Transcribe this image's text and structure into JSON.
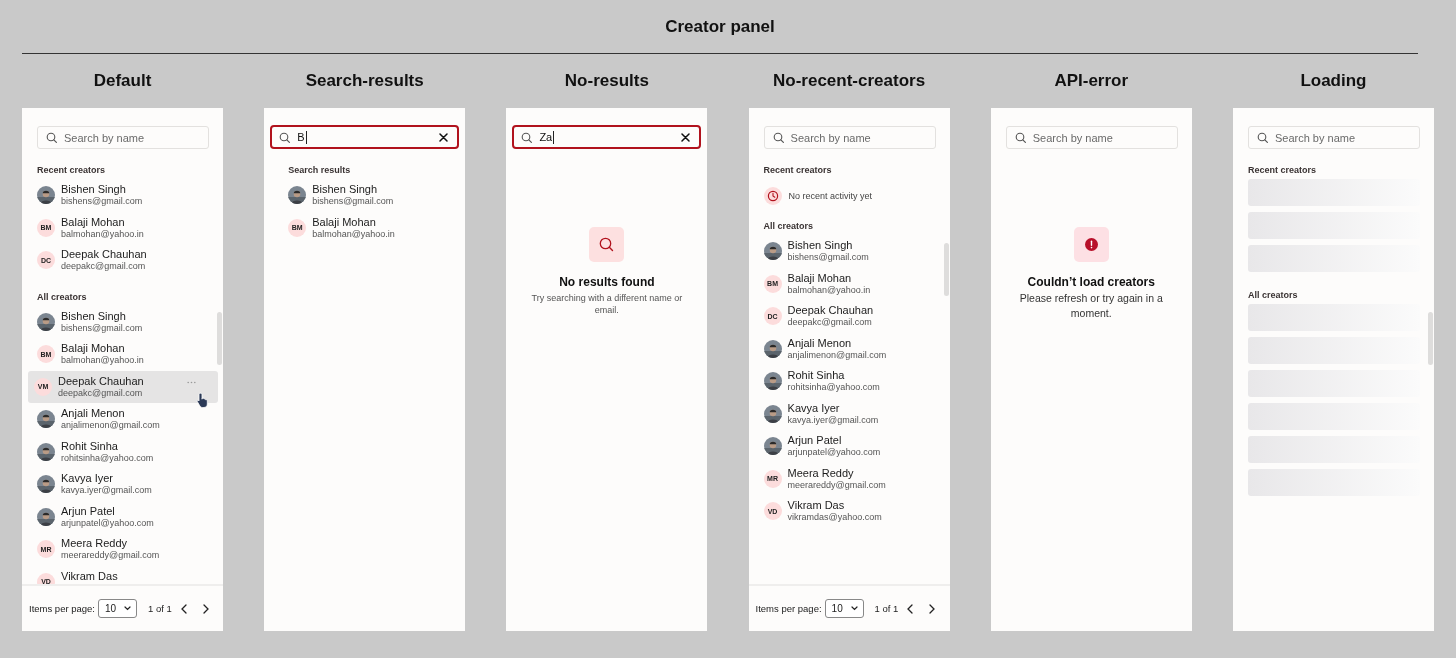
{
  "title": "Creator panel",
  "panels": [
    {
      "kind": "default",
      "title": "Default",
      "search": {
        "placeholder": "Search by name",
        "focused": false
      },
      "sections": [
        {
          "heading": "Recent creators",
          "items": [
            {
              "kind": "creator",
              "name": "Bishen Singh",
              "email": "bishens@gmail.com",
              "hovered": false
            },
            {
              "kind": "creator",
              "name": "Balaji Mohan",
              "email": "balmohan@yahoo.in",
              "avatar": {
                "kind": "initials",
                "text": "BM"
              },
              "hovered": false
            },
            {
              "kind": "creator",
              "name": "Deepak Chauhan",
              "email": "deepakc@gmail.com",
              "avatar": {
                "kind": "initials",
                "text": "DC"
              },
              "hovered": false
            }
          ]
        },
        {
          "heading": "All creators",
          "items": [
            {
              "kind": "creator",
              "name": "Bishen Singh",
              "email": "bishens@gmail.com",
              "hovered": false
            },
            {
              "kind": "creator",
              "name": "Balaji Mohan",
              "email": "balmohan@yahoo.in",
              "avatar": {
                "kind": "initials",
                "text": "BM"
              },
              "hovered": false
            },
            {
              "kind": "creator",
              "name": "Deepak Chauhan",
              "email": "deepakc@gmail.com",
              "avatar": {
                "kind": "initials",
                "text": "VM"
              },
              "hovered": true
            },
            {
              "kind": "creator",
              "name": "Anjali Menon",
              "email": "anjalimenon@gmail.com",
              "hovered": false
            },
            {
              "kind": "creator",
              "name": "Rohit Sinha",
              "email": "rohitsinha@yahoo.com",
              "hovered": false
            },
            {
              "kind": "creator",
              "name": "Kavya Iyer",
              "email": "kavya.iyer@gmail.com",
              "hovered": false
            },
            {
              "kind": "creator",
              "name": "Arjun Patel",
              "email": "arjunpatel@yahoo.com",
              "hovered": false
            },
            {
              "kind": "creator",
              "name": "Meera Reddy",
              "email": "meerareddy@gmail.com",
              "avatar": {
                "kind": "initials",
                "text": "MR"
              },
              "hovered": false
            },
            {
              "kind": "creator",
              "name": "Vikram Das",
              "avatar": {
                "kind": "initials",
                "text": "VD"
              },
              "hovered": false
            }
          ]
        }
      ],
      "pagination": {
        "label": "Items per page:",
        "per_page": "10",
        "page": "1 of 1"
      }
    },
    {
      "kind": "search",
      "title": "Search-results",
      "search": {
        "value": "B",
        "focused": true
      },
      "sections": [
        {
          "heading": "Search results",
          "items": [
            {
              "kind": "creator",
              "name": "Bishen Singh",
              "email": "bishens@gmail.com",
              "hovered": false
            },
            {
              "kind": "creator",
              "name": "Balaji Mohan",
              "email": "balmohan@yahoo.in",
              "avatar": {
                "kind": "initials",
                "text": "BM"
              },
              "hovered": false
            }
          ]
        }
      ]
    },
    {
      "kind": "no-results",
      "title": "No-results",
      "search": {
        "value": "Za",
        "focused": true
      },
      "message": {
        "kind": "no-results",
        "title": "No results found",
        "text": "Try searching with a different name or email."
      }
    },
    {
      "kind": "no-recent",
      "title": "No-recent-creators",
      "search": {
        "placeholder": "Search by name",
        "focused": false
      },
      "sections": [
        {
          "heading": "Recent creators",
          "items": [
            {
              "kind": "empty",
              "text": "No recent activity yet"
            }
          ]
        },
        {
          "heading": "All creators",
          "items": [
            {
              "kind": "creator",
              "name": "Bishen Singh",
              "email": "bishens@gmail.com",
              "hovered": false
            },
            {
              "kind": "creator",
              "name": "Balaji Mohan",
              "email": "balmohan@yahoo.in",
              "avatar": {
                "kind": "initials",
                "text": "BM"
              },
              "hovered": false
            },
            {
              "kind": "creator",
              "name": "Deepak Chauhan",
              "email": "deepakc@gmail.com",
              "avatar": {
                "kind": "initials",
                "text": "DC"
              },
              "hovered": false
            },
            {
              "kind": "creator",
              "name": "Anjali Menon",
              "email": "anjalimenon@gmail.com",
              "hovered": false
            },
            {
              "kind": "creator",
              "name": "Rohit Sinha",
              "email": "rohitsinha@yahoo.com",
              "hovered": false
            },
            {
              "kind": "creator",
              "name": "Kavya Iyer",
              "email": "kavya.iyer@gmail.com",
              "hovered": false
            },
            {
              "kind": "creator",
              "name": "Arjun Patel",
              "email": "arjunpatel@yahoo.com",
              "hovered": false
            },
            {
              "kind": "creator",
              "name": "Meera Reddy",
              "email": "meerareddy@gmail.com",
              "avatar": {
                "kind": "initials",
                "text": "MR"
              },
              "hovered": false
            },
            {
              "kind": "creator",
              "name": "Vikram Das",
              "email": "vikramdas@yahoo.com",
              "avatar": {
                "kind": "initials",
                "text": "VD"
              },
              "hovered": false
            }
          ]
        }
      ],
      "pagination": {
        "label": "Items per page:",
        "per_page": "10",
        "page": "1 of 1"
      }
    },
    {
      "kind": "error",
      "title": "API-error",
      "search": {
        "placeholder": "Search by name",
        "focused": false
      },
      "message": {
        "kind": "error",
        "title": "Couldn’t load creators",
        "text": "Please refresh or try again in a moment."
      }
    },
    {
      "kind": "loading",
      "title": "Loading",
      "search": {
        "placeholder": "Search by name",
        "focused": false
      },
      "sections": [
        {
          "heading": "Recent creators",
          "items": [
            {
              "kind": "skeleton"
            },
            {
              "kind": "skeleton"
            },
            {
              "kind": "skeleton"
            }
          ]
        },
        {
          "heading": "All creators",
          "items": [
            {
              "kind": "skeleton"
            },
            {
              "kind": "skeleton"
            },
            {
              "kind": "skeleton"
            },
            {
              "kind": "skeleton"
            },
            {
              "kind": "skeleton"
            },
            {
              "kind": "skeleton"
            }
          ]
        }
      ]
    }
  ]
}
